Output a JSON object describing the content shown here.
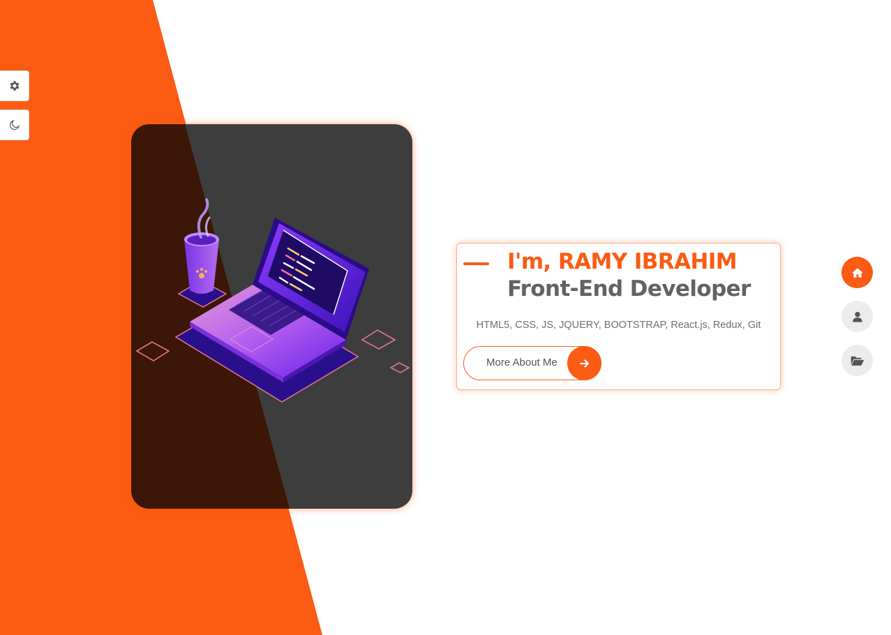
{
  "theme": {
    "accent": "#fb5b13",
    "text_dark": "#626262",
    "card_bg": "#3d3d3d"
  },
  "side_tools": [
    {
      "icon": "gear-icon"
    },
    {
      "icon": "moon-icon"
    }
  ],
  "hero": {
    "illustration": "laptop-and-coffee-cup-illustration"
  },
  "intro": {
    "greeting": "I'm, RAMY IBRAHIM",
    "role": "Front-End Developer",
    "skills": "HTML5, CSS, JS, JQUERY, BOOTSTRAP, React.js, Redux, Git",
    "cta_label": "More About Me",
    "cta_icon": "arrow-right-icon"
  },
  "nav": [
    {
      "icon": "home-icon",
      "active": true
    },
    {
      "icon": "user-icon",
      "active": false
    },
    {
      "icon": "folder-open-icon",
      "active": false
    }
  ]
}
